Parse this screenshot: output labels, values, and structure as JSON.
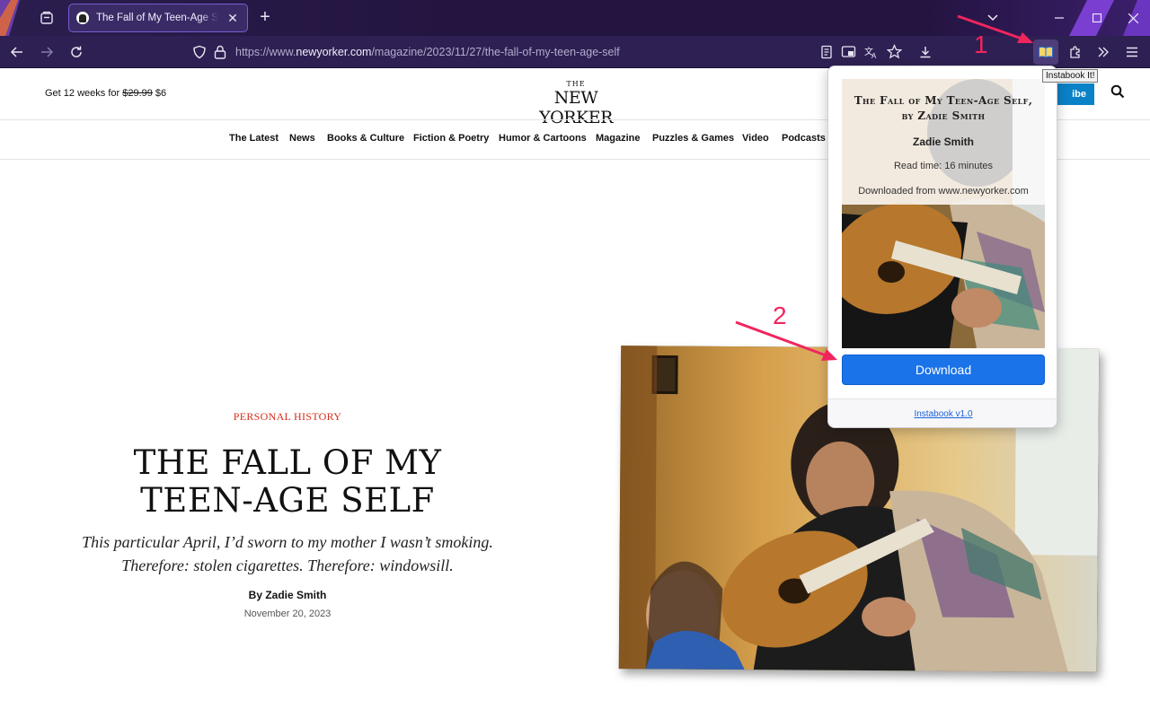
{
  "browser": {
    "tab_title": "The Fall of My Teen-Age Self, by Zadie Smith",
    "url_prefix": "https://www.",
    "url_domain": "newyorker.com",
    "url_path": "/magazine/2023/11/27/the-fall-of-my-teen-age-self",
    "tooltip": "Instabook It!"
  },
  "site": {
    "promo_prefix": "Get 12 weeks for ",
    "promo_old_price": "$29.99",
    "promo_new_price": " $6",
    "logo_the": "THE",
    "logo_name": "NEW YORKER",
    "subscribe_label": "ibe",
    "nav": [
      "The Latest",
      "News",
      "Books & Culture",
      "Fiction & Poetry",
      "Humor & Cartoons",
      "Magazine",
      "Puzzles & Games",
      "Video",
      "Podcasts"
    ]
  },
  "article": {
    "kicker": "PERSONAL HISTORY",
    "headline": "THE FALL OF MY TEEN-AGE SELF",
    "dek": "This particular April, I’d sworn to my mother I wasn’t smoking. Therefore: stolen cigarettes. Therefore: windowsill.",
    "byline": "By Zadie Smith",
    "date": "November 20, 2023"
  },
  "popup": {
    "title": "The Fall of My Teen-Age Self, by Zadie Smith",
    "author": "Zadie Smith",
    "read_time": "Read time: 16 minutes",
    "source": "Downloaded from www.newyorker.com",
    "download_label": "Download",
    "version": "Instabook v1.0"
  },
  "annotations": {
    "step1": "1",
    "step2": "2",
    "color": "#f0255e"
  }
}
